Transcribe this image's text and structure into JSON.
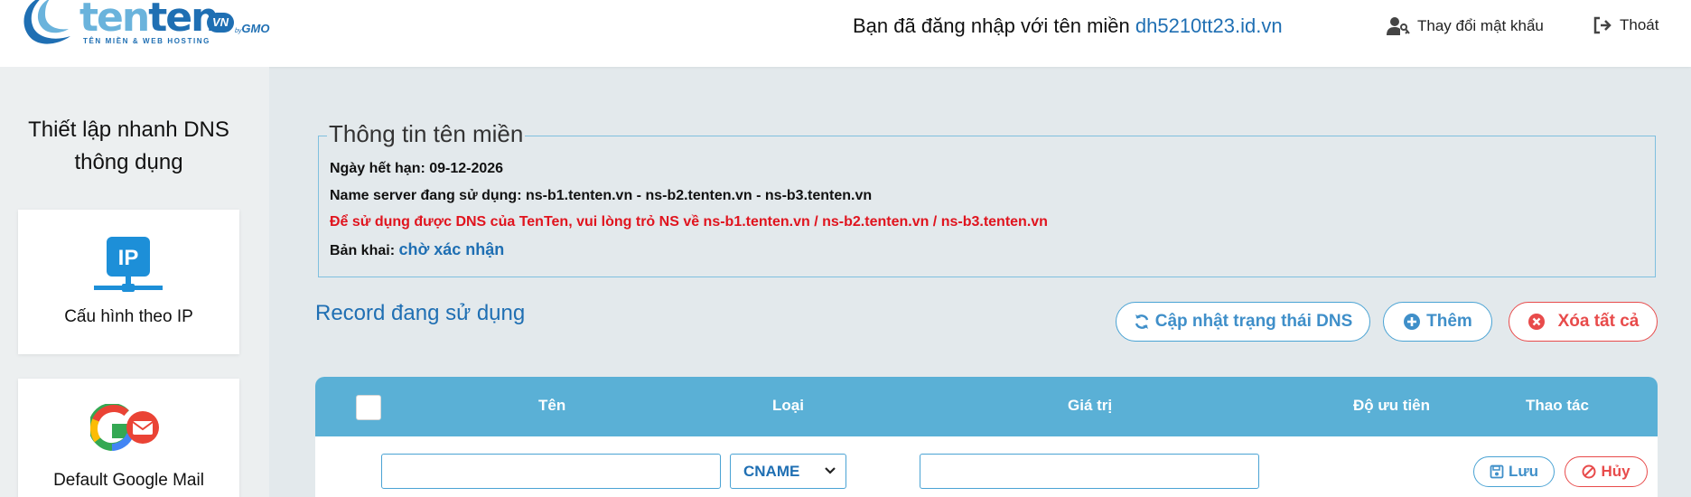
{
  "header": {
    "logo": {
      "word1": "ten",
      "word2": "ten",
      "vn": "VN",
      "gmo_by": "by",
      "gmo": "GMO",
      "tagline": "TÊN MIỀN & WEB HOSTING"
    },
    "login_prefix": "Bạn đã đăng nhập với tên miền ",
    "login_domain": "dh5210tt23.id.vn",
    "change_password": "Thay đổi mật khẩu",
    "logout": "Thoát"
  },
  "sidebar": {
    "title_line1": "Thiết lập nhanh DNS",
    "title_line2": "thông dụng",
    "cards": [
      {
        "label": "Cấu hình theo IP",
        "icon": "ip-network-icon",
        "icon_text": "IP"
      },
      {
        "label": "Default Google Mail",
        "icon": "google-mail-icon"
      }
    ]
  },
  "domain_info": {
    "legend": "Thông tin tên miền",
    "expiry_label": "Ngày hết hạn: ",
    "expiry_value": "09-12-2026",
    "ns_label": "Name server đang sử dụng: ",
    "ns_value": "ns-b1.tenten.vn - ns-b2.tenten.vn - ns-b3.tenten.vn",
    "warning": "Để sử dụng được DNS của TenTen, vui lòng trỏ NS về ns-b1.tenten.vn / ns-b2.tenten.vn / ns-b3.tenten.vn",
    "deploy_label": "Bản khai: ",
    "deploy_status": "chờ xác nhận"
  },
  "records": {
    "title": "Record đang sử dụng",
    "update_button": "Cập nhật trạng thái DNS",
    "add_button": "Thêm",
    "delete_all_button": "Xóa tất cả",
    "columns": [
      "Tên",
      "Loại",
      "Giá trị",
      "Độ ưu tiên",
      "Thao tác"
    ],
    "new_row": {
      "name_value": "",
      "type_selected": "CNAME",
      "value_value": "",
      "save_button": "Lưu",
      "cancel_button": "Hủy"
    }
  },
  "colors": {
    "brand_blue": "#1f6fb3",
    "accent_blue": "#5ab0d6",
    "danger_red": "#e84b4b",
    "warning_red": "#e0141e"
  }
}
